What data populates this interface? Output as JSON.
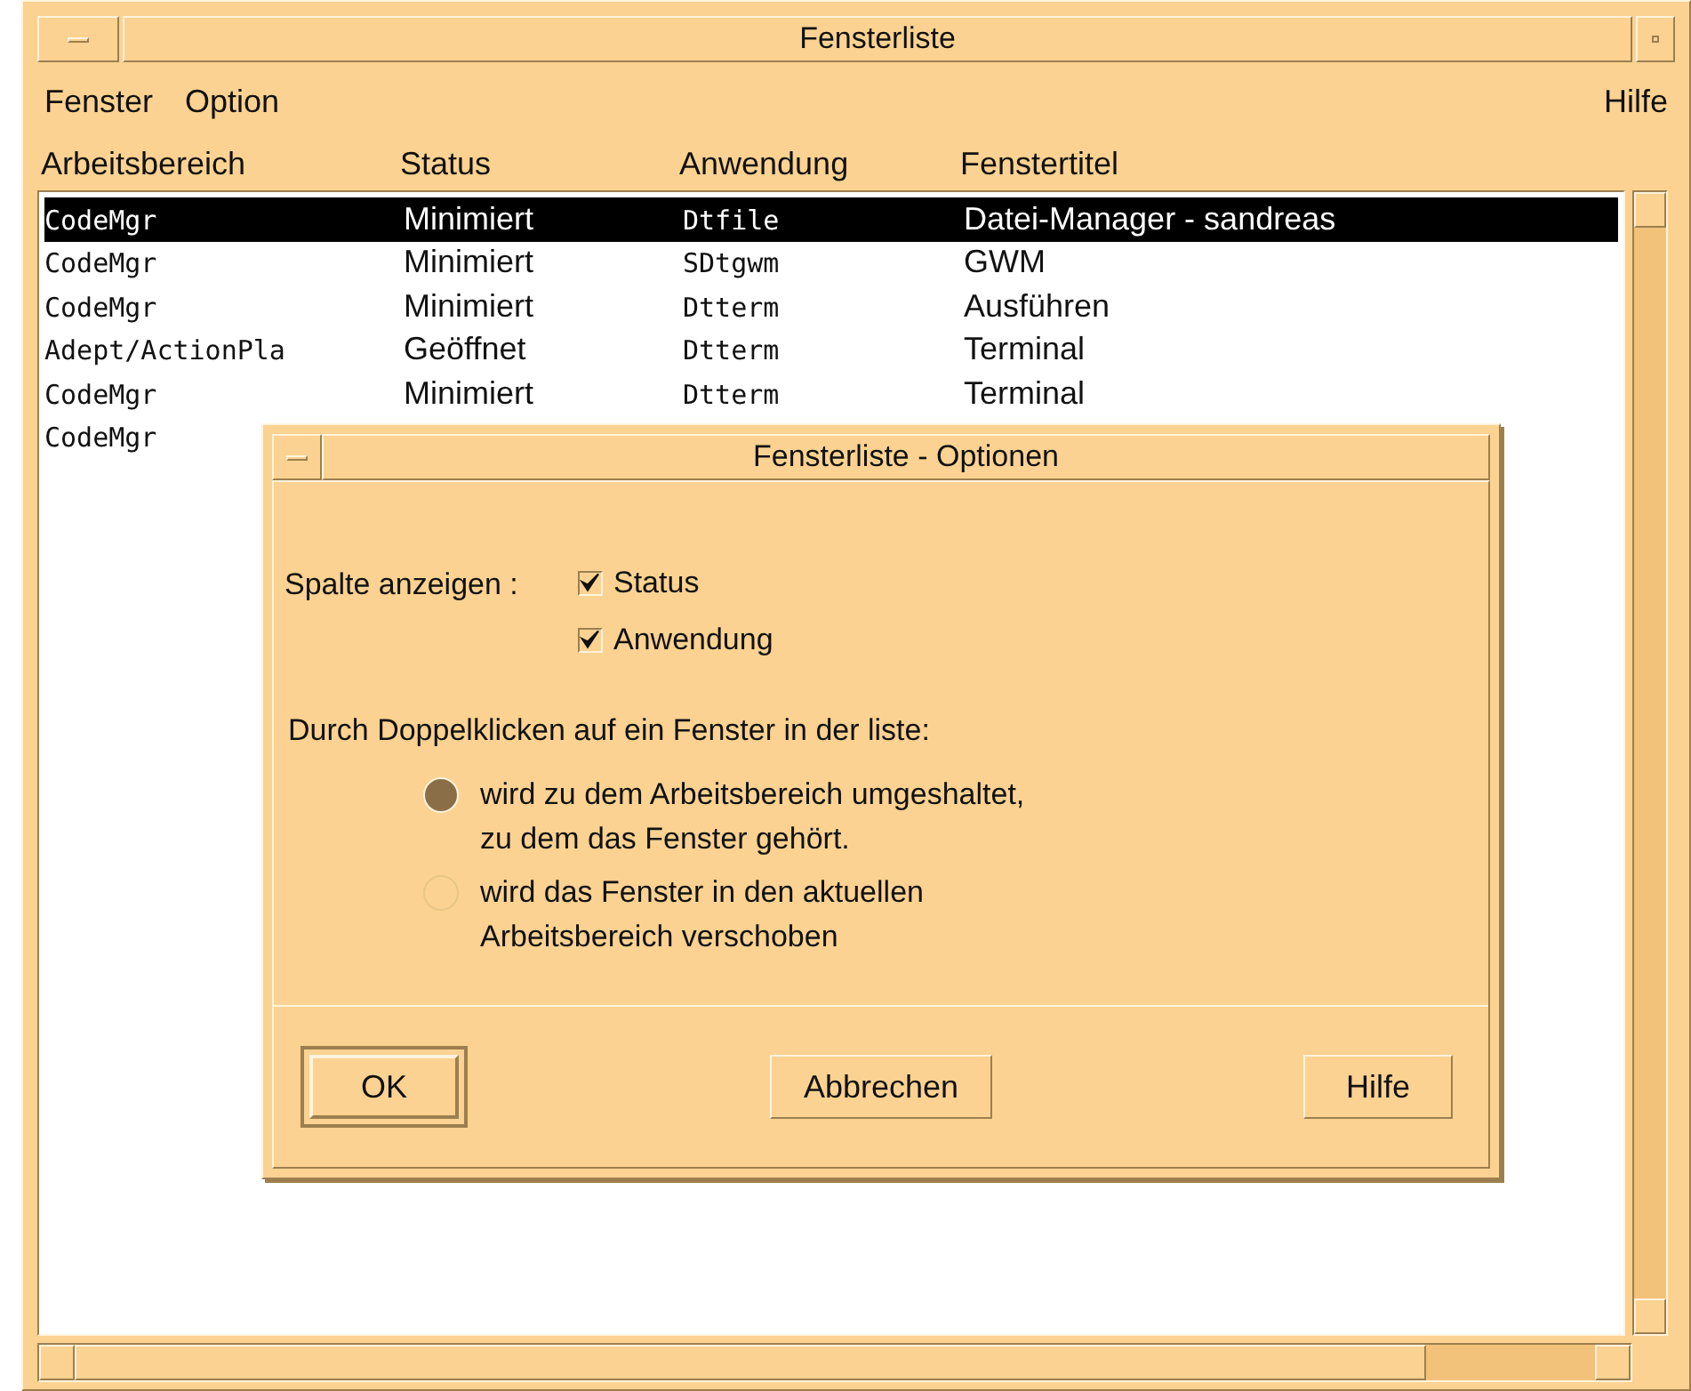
{
  "window": {
    "title": "Fensterliste"
  },
  "menu": [
    "Fenster",
    "Option"
  ],
  "help_menu": "Hilfe",
  "table": {
    "columns": [
      "Arbeitsbereich",
      "Status",
      "Anwendung",
      "Fenstertitel"
    ],
    "rows": [
      {
        "cells": [
          "CodeMgr",
          "Minimiert",
          "Dtfile",
          "Datei-Manager - sandreas"
        ],
        "selected": true
      },
      {
        "cells": [
          "CodeMgr",
          "Minimiert",
          "SDtgwm",
          "GWM"
        ],
        "selected": false
      },
      {
        "cells": [
          "CodeMgr",
          "Minimiert",
          "Dtterm",
          "Ausführen"
        ],
        "selected": false
      },
      {
        "cells": [
          "Adept/ActionPla",
          "Geöffnet",
          "Dtterm",
          "Terminal"
        ],
        "selected": false
      },
      {
        "cells": [
          "CodeMgr",
          "Minimiert",
          "Dtterm",
          "Terminal"
        ],
        "selected": false
      },
      {
        "cells": [
          "CodeMgr"
        ],
        "selected": false
      }
    ]
  },
  "dialog": {
    "title": "Fensterliste - Optionen",
    "columns_label": "Spalte anzeigen :",
    "checkboxes": [
      {
        "label": "Status",
        "checked": true
      },
      {
        "label": "Anwendung",
        "checked": true
      }
    ],
    "double_click_label": "Durch Doppelklicken auf ein Fenster in der liste:",
    "radios": [
      {
        "lines": [
          "wird zu dem Arbeitsbereich umgeshaltet,",
          "zu dem das Fenster gehört."
        ],
        "selected": true
      },
      {
        "lines": [
          "wird das Fenster in den aktuellen",
          "Arbeitsbereich verschoben"
        ],
        "selected": false
      }
    ],
    "buttons": [
      {
        "label": "OK",
        "default": true
      },
      {
        "label": "Abbrechen",
        "default": false
      },
      {
        "label": "Hilfe",
        "default": false
      }
    ]
  }
}
